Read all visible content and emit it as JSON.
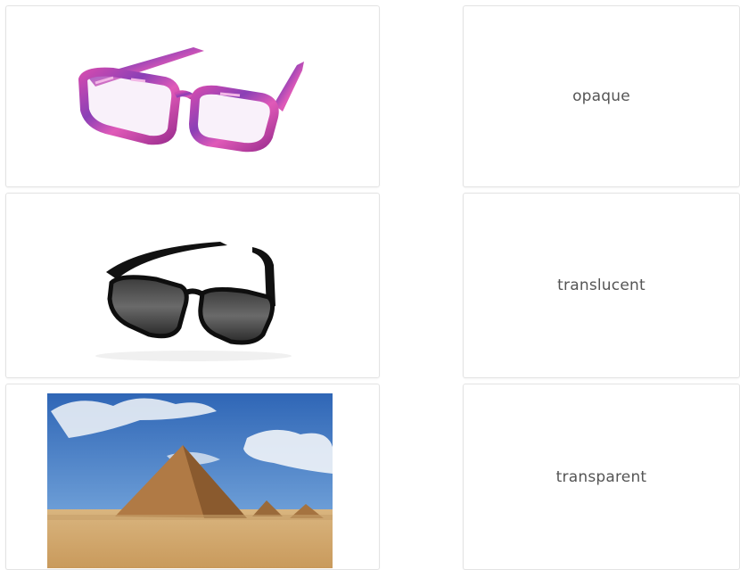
{
  "images": [
    {
      "id": "colorful-eyeglasses",
      "icon": "colorful-eyeglasses-image"
    },
    {
      "id": "sunglasses",
      "icon": "black-sunglasses-image"
    },
    {
      "id": "pyramid",
      "icon": "pyramid-desert-photo"
    }
  ],
  "words": [
    {
      "label": "opaque"
    },
    {
      "label": "translucent"
    },
    {
      "label": "transparent"
    }
  ],
  "colors": {
    "card_border": "#e3e3e3",
    "text": "#555555",
    "frame_purple": "#b2349a",
    "sky_blue": "#3f78c4",
    "sand": "#d8b27a"
  }
}
